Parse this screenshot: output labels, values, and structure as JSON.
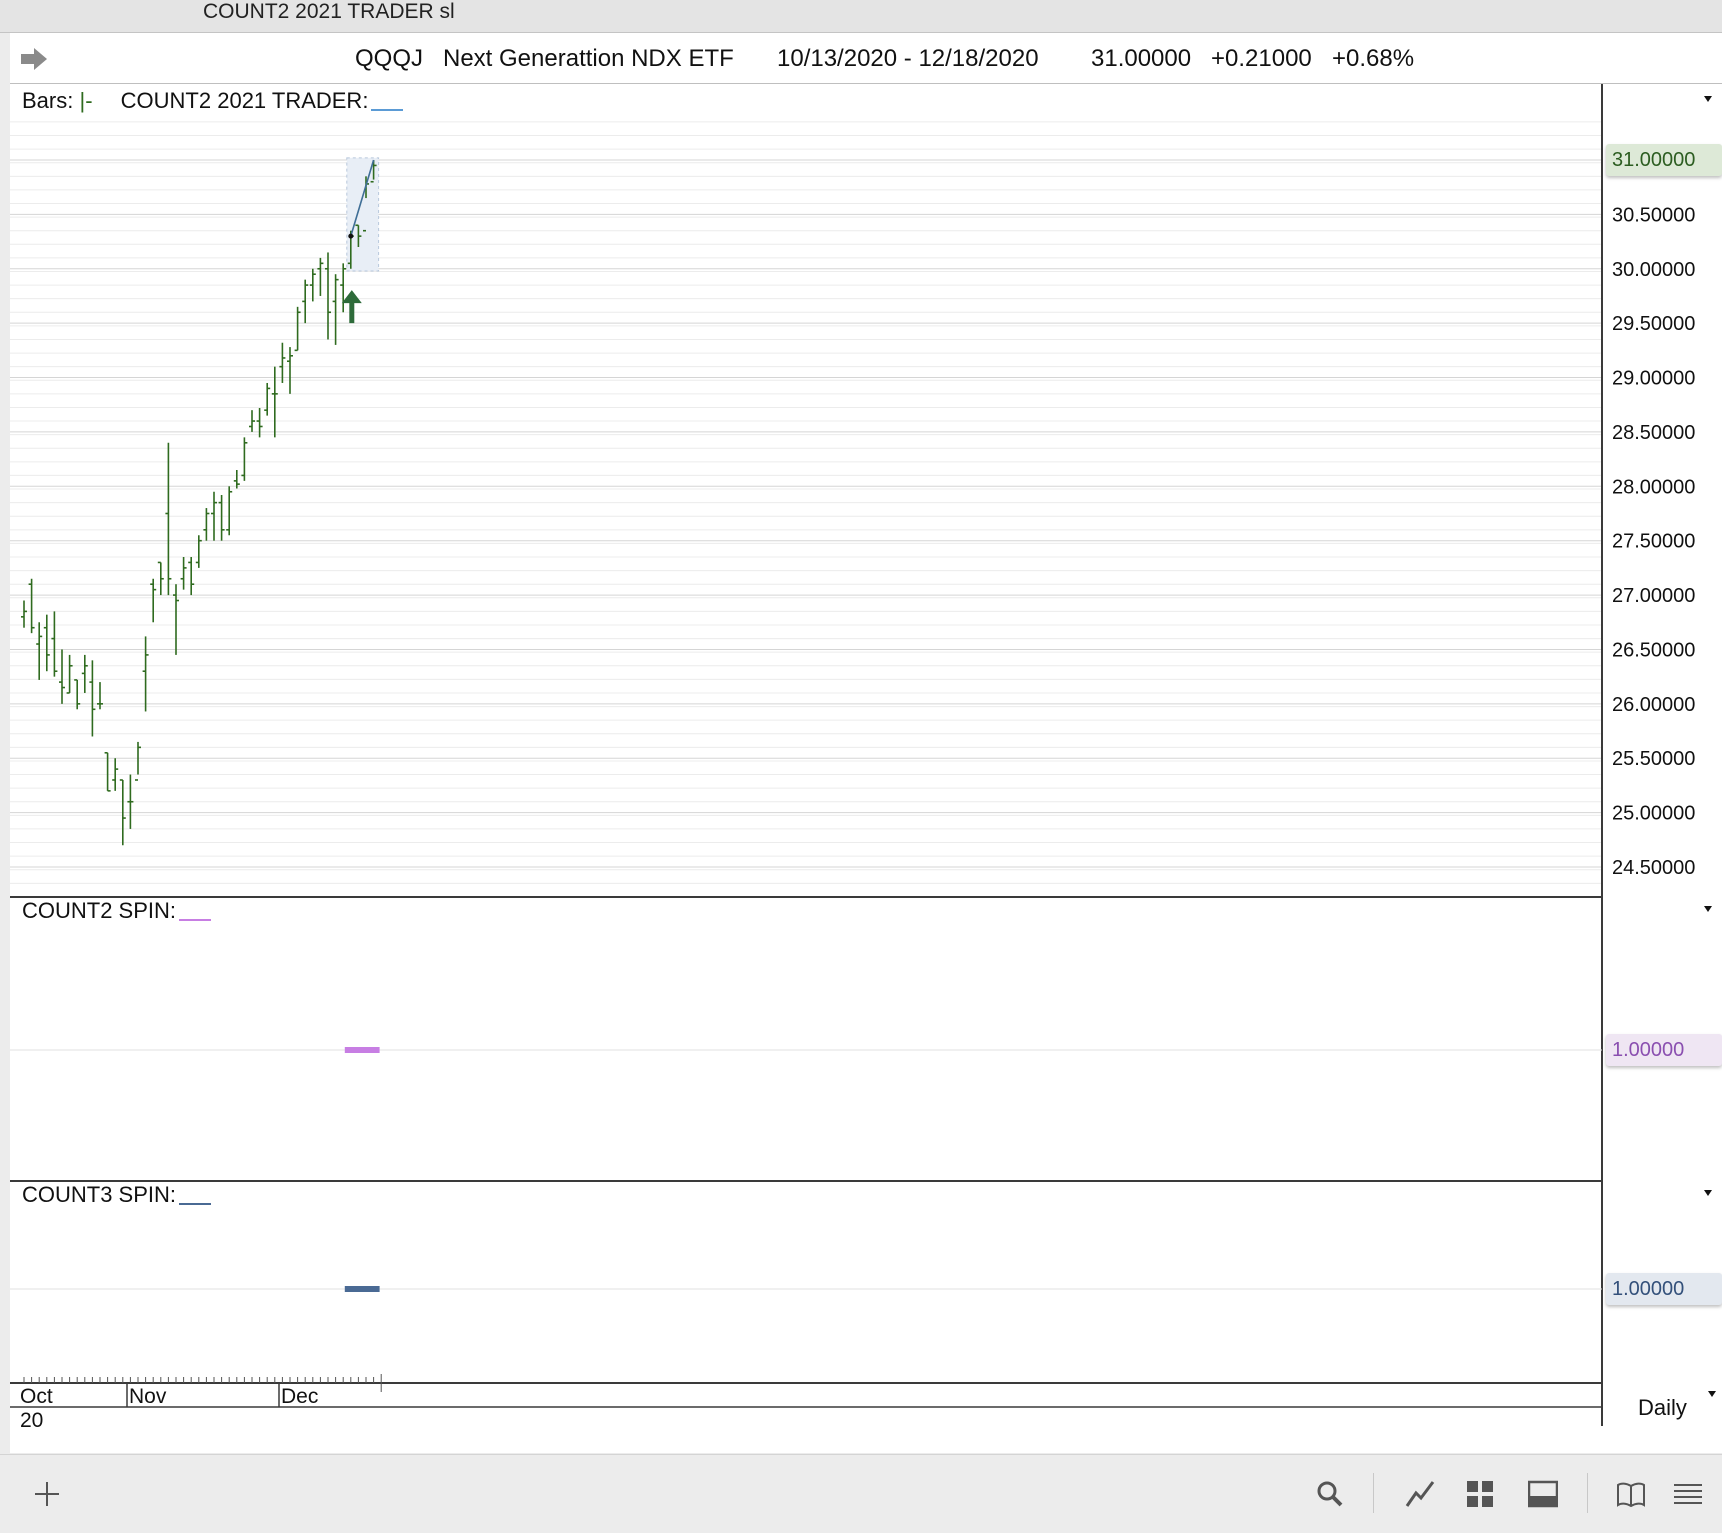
{
  "window": {
    "title": "COUNT2 2021 TRADER sl"
  },
  "quote": {
    "symbol": "QQQJ",
    "name": "Next Generattion NDX ETF",
    "range": "10/13/2020 - 12/18/2020",
    "last": "31.00000",
    "change": "+0.21000",
    "change_pct": "+0.68%"
  },
  "panes": {
    "price": {
      "bars_label": "Bars:",
      "bars_symbol": "|-",
      "indicator_label": "COUNT2 2021 TRADER:",
      "indicator_color": "#5b9bd5"
    },
    "spin2": {
      "label": "COUNT2 SPIN:",
      "value": "1.00000",
      "color": "#c77ee3"
    },
    "spin3": {
      "label": "COUNT3 SPIN:",
      "value": "1.00000",
      "color": "#4a6a94"
    }
  },
  "timeframe": "Daily",
  "colors": {
    "bars": "#2f6b1f",
    "arrow": "#2e6b3a",
    "indicator_line": "#3f6e96",
    "last_badge_bg": "#dde9d7",
    "last_badge_text": "#2c5d21"
  },
  "chart_data": {
    "type": "ohlc",
    "y_ticks": [
      "31.00000",
      "30.50000",
      "30.00000",
      "29.50000",
      "29.00000",
      "28.50000",
      "28.00000",
      "27.50000",
      "27.00000",
      "26.50000",
      "26.00000",
      "25.50000",
      "25.00000",
      "24.50000"
    ],
    "x_labels": [
      {
        "label": "Oct",
        "sub": "20",
        "index": 0
      },
      {
        "label": "Nov",
        "index": 15
      },
      {
        "label": "Dec",
        "index": 35
      }
    ],
    "ylim": [
      24.25,
      31.7
    ],
    "last_price": 31.0,
    "bars": [
      {
        "date": "10/13",
        "o": 26.8,
        "h": 26.95,
        "l": 26.7,
        "c": 26.85
      },
      {
        "date": "10/14",
        "o": 27.1,
        "h": 27.15,
        "l": 26.65,
        "c": 26.7
      },
      {
        "date": "10/15",
        "o": 26.55,
        "h": 26.75,
        "l": 26.22,
        "c": 26.62
      },
      {
        "date": "10/16",
        "o": 26.7,
        "h": 26.82,
        "l": 26.3,
        "c": 26.45
      },
      {
        "date": "10/19",
        "o": 26.6,
        "h": 26.85,
        "l": 26.25,
        "c": 26.3
      },
      {
        "date": "10/20",
        "o": 26.2,
        "h": 26.5,
        "l": 26.0,
        "c": 26.15
      },
      {
        "date": "10/21",
        "o": 26.1,
        "h": 26.45,
        "l": 26.1,
        "c": 26.35
      },
      {
        "date": "10/22",
        "o": 26.22,
        "h": 26.22,
        "l": 25.95,
        "c": 26.0
      },
      {
        "date": "10/23",
        "o": 26.28,
        "h": 26.45,
        "l": 26.1,
        "c": 26.35
      },
      {
        "date": "10/26",
        "o": 26.2,
        "h": 26.4,
        "l": 25.7,
        "c": 25.95
      },
      {
        "date": "10/27",
        "o": 26.0,
        "h": 26.2,
        "l": 25.95,
        "c": 26.0
      },
      {
        "date": "10/28",
        "o": 25.55,
        "h": 25.55,
        "l": 25.2,
        "c": 25.2
      },
      {
        "date": "10/29",
        "o": 25.3,
        "h": 25.5,
        "l": 25.2,
        "c": 25.4
      },
      {
        "date": "10/30",
        "o": 25.3,
        "h": 25.3,
        "l": 24.7,
        "c": 24.95
      },
      {
        "date": "11/02",
        "o": 25.1,
        "h": 25.35,
        "l": 24.85,
        "c": 25.1
      },
      {
        "date": "11/03",
        "o": 25.3,
        "h": 25.65,
        "l": 25.35,
        "c": 25.6
      },
      {
        "date": "11/04",
        "o": 26.3,
        "h": 26.62,
        "l": 25.93,
        "c": 26.45
      },
      {
        "date": "11/05",
        "o": 27.1,
        "h": 27.15,
        "l": 26.75,
        "c": 27.05
      },
      {
        "date": "11/06",
        "o": 27.3,
        "h": 27.3,
        "l": 27.0,
        "c": 27.15
      },
      {
        "date": "11/09",
        "o": 27.75,
        "h": 28.4,
        "l": 27.0,
        "c": 27.15
      },
      {
        "date": "11/10",
        "o": 27.0,
        "h": 27.1,
        "l": 26.45,
        "c": 26.95
      },
      {
        "date": "11/11",
        "o": 27.15,
        "h": 27.35,
        "l": 27.05,
        "c": 27.25
      },
      {
        "date": "11/12",
        "o": 27.3,
        "h": 27.35,
        "l": 27.0,
        "c": 27.1
      },
      {
        "date": "11/13",
        "o": 27.3,
        "h": 27.55,
        "l": 27.25,
        "c": 27.5
      },
      {
        "date": "11/16",
        "o": 27.6,
        "h": 27.8,
        "l": 27.5,
        "c": 27.75
      },
      {
        "date": "11/17",
        "o": 27.75,
        "h": 27.95,
        "l": 27.5,
        "c": 27.85
      },
      {
        "date": "11/18",
        "o": 27.85,
        "h": 27.92,
        "l": 27.5,
        "c": 27.6
      },
      {
        "date": "11/19",
        "o": 27.6,
        "h": 28.0,
        "l": 27.55,
        "c": 27.95
      },
      {
        "date": "11/20",
        "o": 28.05,
        "h": 28.15,
        "l": 27.98,
        "c": 28.02
      },
      {
        "date": "11/23",
        "o": 28.1,
        "h": 28.45,
        "l": 28.05,
        "c": 28.4
      },
      {
        "date": "11/24",
        "o": 28.55,
        "h": 28.7,
        "l": 28.5,
        "c": 28.6
      },
      {
        "date": "11/25",
        "o": 28.6,
        "h": 28.72,
        "l": 28.45,
        "c": 28.55
      },
      {
        "date": "11/27",
        "o": 28.7,
        "h": 28.95,
        "l": 28.65,
        "c": 28.9
      },
      {
        "date": "11/30",
        "o": 28.85,
        "h": 29.1,
        "l": 28.45,
        "c": 28.85
      },
      {
        "date": "12/01",
        "o": 29.1,
        "h": 29.32,
        "l": 28.95,
        "c": 29.18
      },
      {
        "date": "12/02",
        "o": 29.15,
        "h": 29.28,
        "l": 28.85,
        "c": 29.2
      },
      {
        "date": "12/03",
        "o": 29.25,
        "h": 29.65,
        "l": 29.25,
        "c": 29.6
      },
      {
        "date": "12/04",
        "o": 29.7,
        "h": 29.9,
        "l": 29.5,
        "c": 29.85
      },
      {
        "date": "12/07",
        "o": 29.85,
        "h": 30.0,
        "l": 29.7,
        "c": 29.95
      },
      {
        "date": "12/08",
        "o": 30.0,
        "h": 30.1,
        "l": 29.75,
        "c": 30.05
      },
      {
        "date": "12/09",
        "o": 30.0,
        "h": 30.15,
        "l": 29.35,
        "c": 29.6
      },
      {
        "date": "12/10",
        "o": 29.7,
        "h": 29.95,
        "l": 29.3,
        "c": 29.9
      },
      {
        "date": "12/11",
        "o": 29.85,
        "h": 30.05,
        "l": 29.6,
        "c": 30.0
      },
      {
        "date": "12/14",
        "o": 30.05,
        "h": 30.35,
        "l": 30.0,
        "c": 30.3
      },
      {
        "date": "12/15",
        "o": 30.4,
        "h": 30.4,
        "l": 30.2,
        "c": 30.3
      },
      {
        "date": "12/16",
        "o": 30.35,
        "h": 30.85,
        "l": 30.65,
        "c": 30.78
      },
      {
        "date": "12/17",
        "o": 30.8,
        "h": 31.0,
        "l": 30.82,
        "c": 30.95
      }
    ],
    "signal_arrow_index": 43,
    "indicator_line": [
      {
        "index": 43,
        "value": 30.3
      },
      {
        "index": 46,
        "value": 31.0
      }
    ],
    "spin2_bars": [
      {
        "from": 43,
        "to": 46,
        "value": 1.0
      }
    ],
    "spin3_bars": [
      {
        "from": 43,
        "to": 46,
        "value": 1.0
      }
    ]
  }
}
